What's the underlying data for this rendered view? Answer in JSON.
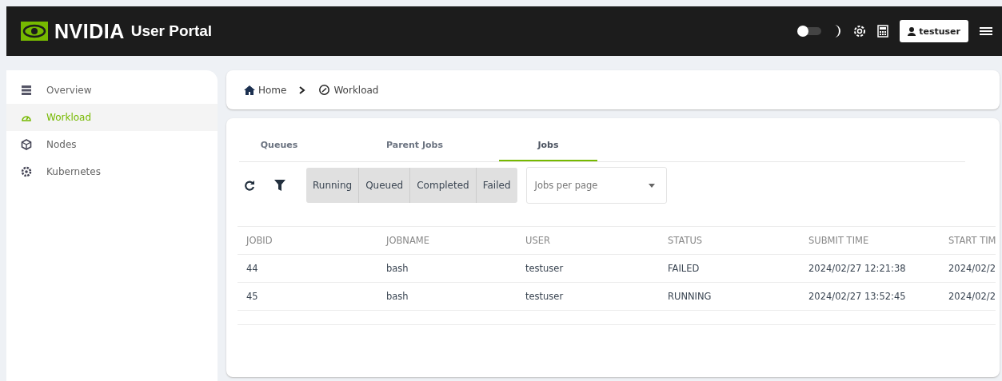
{
  "header": {
    "brand": "NVIDIA",
    "title": "User Portal",
    "user": "testuser"
  },
  "sidebar": {
    "items": [
      {
        "label": "Overview",
        "selected": false
      },
      {
        "label": "Workload",
        "selected": true
      },
      {
        "label": "Nodes",
        "selected": false
      },
      {
        "label": "Kubernetes",
        "selected": false
      }
    ]
  },
  "breadcrumb": [
    "Home",
    "Workload"
  ],
  "tabs": [
    {
      "label": "Queues",
      "selected": false
    },
    {
      "label": "Parent Jobs",
      "selected": false
    },
    {
      "label": "Jobs",
      "selected": true
    }
  ],
  "filters": [
    "Running",
    "Queued",
    "Completed",
    "Failed"
  ],
  "page_size": {
    "placeholder": "Jobs per page"
  },
  "table": {
    "columns": [
      "JOBID",
      "JOBNAME",
      "USER",
      "STATUS",
      "SUBMIT TIME",
      "START TIM"
    ],
    "rows": [
      [
        "44",
        "bash",
        "testuser",
        "FAILED",
        "2024/02/27 12:21:38",
        "2024/02/2"
      ],
      [
        "45",
        "bash",
        "testuser",
        "RUNNING",
        "2024/02/27 13:52:45",
        "2024/02/2"
      ]
    ]
  }
}
